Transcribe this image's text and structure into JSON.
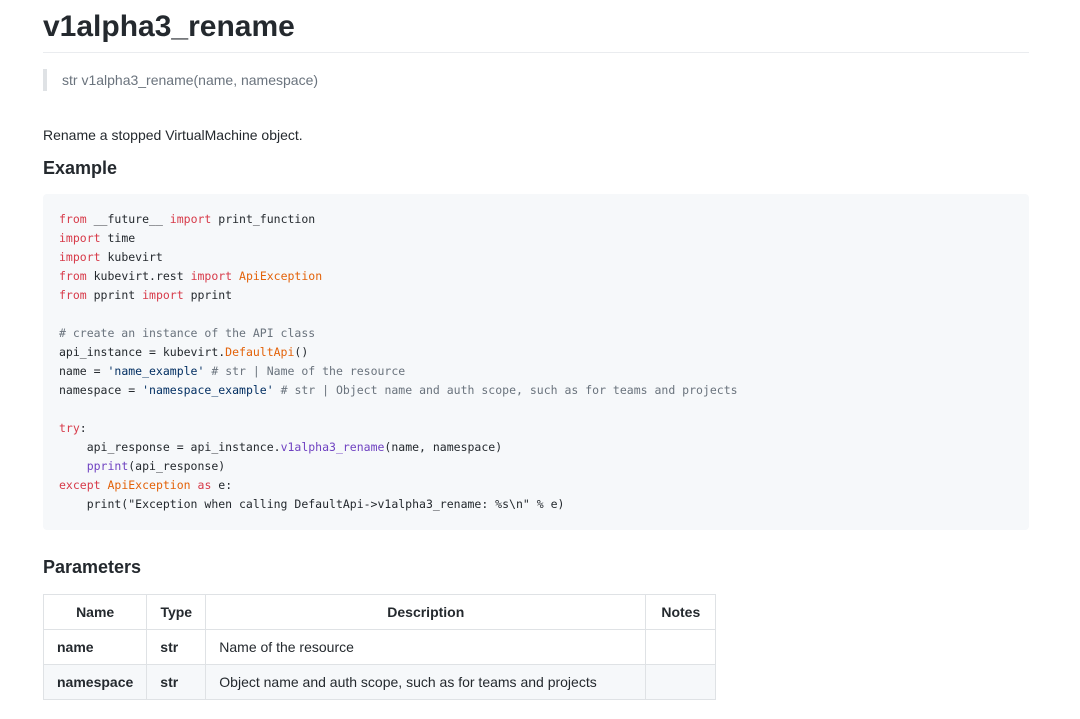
{
  "title": "v1alpha3_rename",
  "signature": "str v1alpha3_rename(name, namespace)",
  "description": "Rename a stopped VirtualMachine object.",
  "example_heading": "Example",
  "parameters_heading": "Parameters",
  "code": {
    "l1": {
      "a": "from",
      "b": " __future__ ",
      "c": "import",
      "d": " print_function"
    },
    "l2": {
      "a": "import",
      "b": " time"
    },
    "l3": {
      "a": "import",
      "b": " kubevirt"
    },
    "l4": {
      "a": "from",
      "b": " kubevirt.rest ",
      "c": "import",
      "d": " ",
      "e": "ApiException"
    },
    "l5": {
      "a": "from",
      "b": " pprint ",
      "c": "import",
      "d": " pprint"
    },
    "l7": {
      "a": "# create an instance of the API class"
    },
    "l8": {
      "a": "api_instance = kubevirt.",
      "b": "DefaultApi",
      "c": "()"
    },
    "l9": {
      "a": "name = ",
      "b": "'name_example'",
      "c": " ",
      "d": "# str | Name of the resource"
    },
    "l10": {
      "a": "namespace = ",
      "b": "'namespace_example'",
      "c": " ",
      "d": "# str | Object name and auth scope, such as for teams and projects"
    },
    "l12": {
      "a": "try",
      "b": ":"
    },
    "l13": {
      "a": "    api_response = api_instance.",
      "b": "v1alpha3_rename",
      "c": "(name, namespace)"
    },
    "l14": {
      "a": "    ",
      "b": "pprint",
      "c": "(api_response)"
    },
    "l15": {
      "a": "except",
      "b": " ",
      "c": "ApiException",
      "d": " ",
      "e": "as",
      "f": " e:"
    },
    "l16": {
      "a": "    print(\"Exception when calling DefaultApi->v1alpha3_rename: %s\\n\" % e)"
    }
  },
  "params_table": {
    "headers": [
      "Name",
      "Type",
      "Description",
      "Notes"
    ],
    "rows": [
      [
        "name",
        "str",
        "Name of the resource",
        ""
      ],
      [
        "namespace",
        "str",
        "Object name and auth scope, such as for teams and projects",
        ""
      ]
    ]
  }
}
